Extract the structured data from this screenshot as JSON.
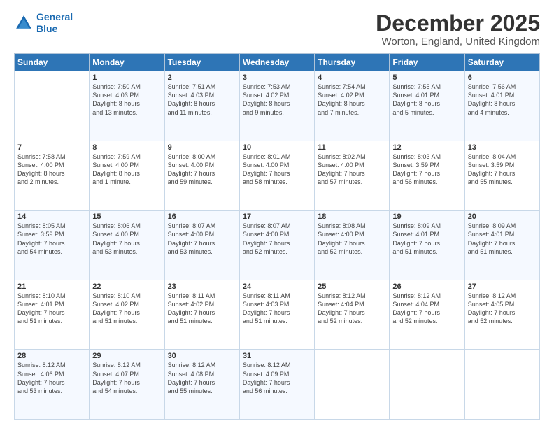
{
  "logo": {
    "line1": "General",
    "line2": "Blue"
  },
  "title": "December 2025",
  "subtitle": "Worton, England, United Kingdom",
  "header_days": [
    "Sunday",
    "Monday",
    "Tuesday",
    "Wednesday",
    "Thursday",
    "Friday",
    "Saturday"
  ],
  "weeks": [
    [
      {
        "day": "",
        "text": ""
      },
      {
        "day": "1",
        "text": "Sunrise: 7:50 AM\nSunset: 4:03 PM\nDaylight: 8 hours\nand 13 minutes."
      },
      {
        "day": "2",
        "text": "Sunrise: 7:51 AM\nSunset: 4:03 PM\nDaylight: 8 hours\nand 11 minutes."
      },
      {
        "day": "3",
        "text": "Sunrise: 7:53 AM\nSunset: 4:02 PM\nDaylight: 8 hours\nand 9 minutes."
      },
      {
        "day": "4",
        "text": "Sunrise: 7:54 AM\nSunset: 4:02 PM\nDaylight: 8 hours\nand 7 minutes."
      },
      {
        "day": "5",
        "text": "Sunrise: 7:55 AM\nSunset: 4:01 PM\nDaylight: 8 hours\nand 5 minutes."
      },
      {
        "day": "6",
        "text": "Sunrise: 7:56 AM\nSunset: 4:01 PM\nDaylight: 8 hours\nand 4 minutes."
      }
    ],
    [
      {
        "day": "7",
        "text": "Sunrise: 7:58 AM\nSunset: 4:00 PM\nDaylight: 8 hours\nand 2 minutes."
      },
      {
        "day": "8",
        "text": "Sunrise: 7:59 AM\nSunset: 4:00 PM\nDaylight: 8 hours\nand 1 minute."
      },
      {
        "day": "9",
        "text": "Sunrise: 8:00 AM\nSunset: 4:00 PM\nDaylight: 7 hours\nand 59 minutes."
      },
      {
        "day": "10",
        "text": "Sunrise: 8:01 AM\nSunset: 4:00 PM\nDaylight: 7 hours\nand 58 minutes."
      },
      {
        "day": "11",
        "text": "Sunrise: 8:02 AM\nSunset: 4:00 PM\nDaylight: 7 hours\nand 57 minutes."
      },
      {
        "day": "12",
        "text": "Sunrise: 8:03 AM\nSunset: 3:59 PM\nDaylight: 7 hours\nand 56 minutes."
      },
      {
        "day": "13",
        "text": "Sunrise: 8:04 AM\nSunset: 3:59 PM\nDaylight: 7 hours\nand 55 minutes."
      }
    ],
    [
      {
        "day": "14",
        "text": "Sunrise: 8:05 AM\nSunset: 3:59 PM\nDaylight: 7 hours\nand 54 minutes."
      },
      {
        "day": "15",
        "text": "Sunrise: 8:06 AM\nSunset: 4:00 PM\nDaylight: 7 hours\nand 53 minutes."
      },
      {
        "day": "16",
        "text": "Sunrise: 8:07 AM\nSunset: 4:00 PM\nDaylight: 7 hours\nand 53 minutes."
      },
      {
        "day": "17",
        "text": "Sunrise: 8:07 AM\nSunset: 4:00 PM\nDaylight: 7 hours\nand 52 minutes."
      },
      {
        "day": "18",
        "text": "Sunrise: 8:08 AM\nSunset: 4:00 PM\nDaylight: 7 hours\nand 52 minutes."
      },
      {
        "day": "19",
        "text": "Sunrise: 8:09 AM\nSunset: 4:01 PM\nDaylight: 7 hours\nand 51 minutes."
      },
      {
        "day": "20",
        "text": "Sunrise: 8:09 AM\nSunset: 4:01 PM\nDaylight: 7 hours\nand 51 minutes."
      }
    ],
    [
      {
        "day": "21",
        "text": "Sunrise: 8:10 AM\nSunset: 4:01 PM\nDaylight: 7 hours\nand 51 minutes."
      },
      {
        "day": "22",
        "text": "Sunrise: 8:10 AM\nSunset: 4:02 PM\nDaylight: 7 hours\nand 51 minutes."
      },
      {
        "day": "23",
        "text": "Sunrise: 8:11 AM\nSunset: 4:02 PM\nDaylight: 7 hours\nand 51 minutes."
      },
      {
        "day": "24",
        "text": "Sunrise: 8:11 AM\nSunset: 4:03 PM\nDaylight: 7 hours\nand 51 minutes."
      },
      {
        "day": "25",
        "text": "Sunrise: 8:12 AM\nSunset: 4:04 PM\nDaylight: 7 hours\nand 52 minutes."
      },
      {
        "day": "26",
        "text": "Sunrise: 8:12 AM\nSunset: 4:04 PM\nDaylight: 7 hours\nand 52 minutes."
      },
      {
        "day": "27",
        "text": "Sunrise: 8:12 AM\nSunset: 4:05 PM\nDaylight: 7 hours\nand 52 minutes."
      }
    ],
    [
      {
        "day": "28",
        "text": "Sunrise: 8:12 AM\nSunset: 4:06 PM\nDaylight: 7 hours\nand 53 minutes."
      },
      {
        "day": "29",
        "text": "Sunrise: 8:12 AM\nSunset: 4:07 PM\nDaylight: 7 hours\nand 54 minutes."
      },
      {
        "day": "30",
        "text": "Sunrise: 8:12 AM\nSunset: 4:08 PM\nDaylight: 7 hours\nand 55 minutes."
      },
      {
        "day": "31",
        "text": "Sunrise: 8:12 AM\nSunset: 4:09 PM\nDaylight: 7 hours\nand 56 minutes."
      },
      {
        "day": "",
        "text": ""
      },
      {
        "day": "",
        "text": ""
      },
      {
        "day": "",
        "text": ""
      }
    ]
  ]
}
